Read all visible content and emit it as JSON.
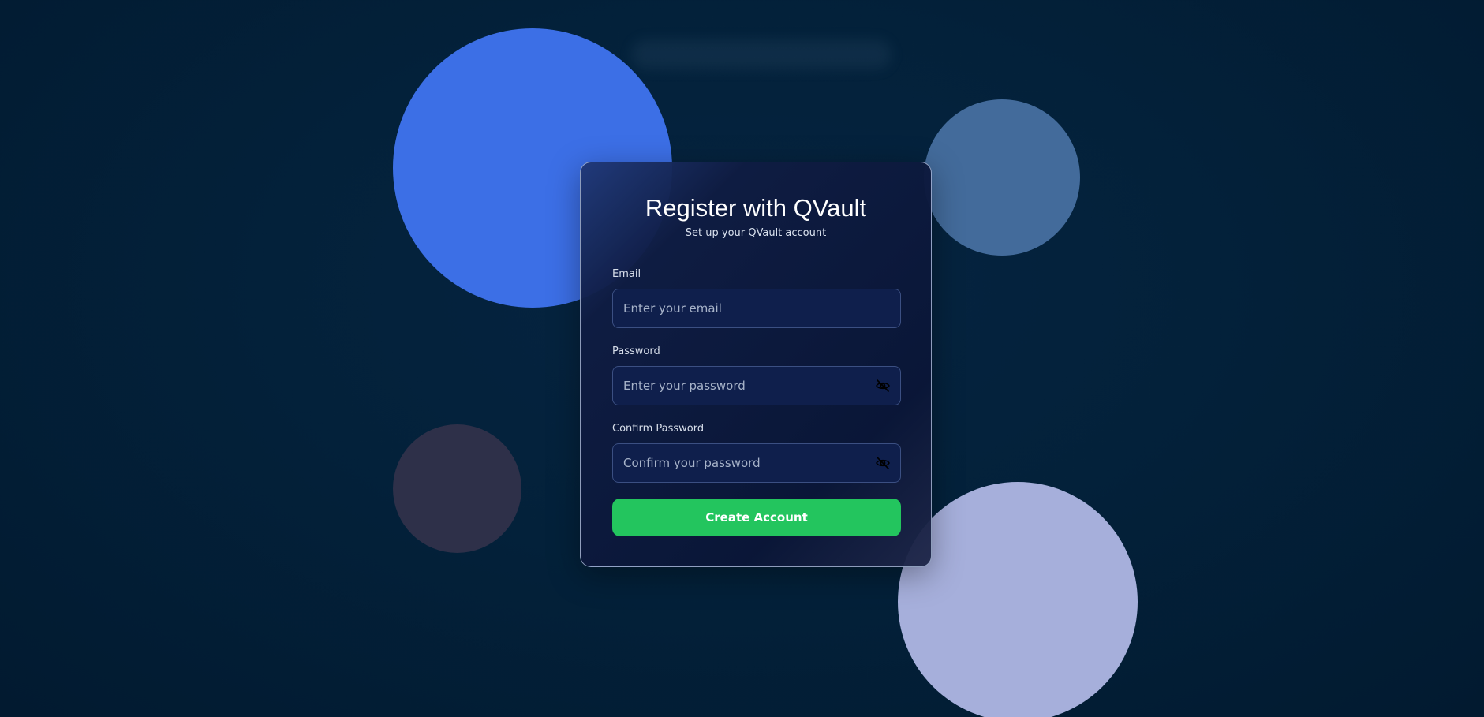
{
  "page": {
    "title": "Register with QVault",
    "subtitle": "Set up your QVault account"
  },
  "form": {
    "email": {
      "label": "Email",
      "placeholder": "Enter your email",
      "value": ""
    },
    "password": {
      "label": "Password",
      "placeholder": "Enter your password",
      "value": "",
      "toggle_icon": "eye-off-icon"
    },
    "confirm_password": {
      "label": "Confirm Password",
      "placeholder": "Confirm your password",
      "value": "",
      "toggle_icon": "eye-off-icon"
    },
    "submit_label": "Create Account"
  },
  "colors": {
    "background": "#03213a",
    "card": "#0f1c42",
    "input": "#0f1f4c",
    "accent_green": "#23c55e",
    "blob_blue": "#3c6fe6",
    "blob_steel": "#436b9b",
    "blob_dark": "#2e3049",
    "blob_lavender": "#a6afdb"
  }
}
